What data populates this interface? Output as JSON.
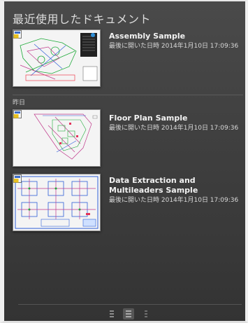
{
  "panel": {
    "title": "最近使用したドキュメント"
  },
  "groups": [
    {
      "label": "",
      "items": [
        {
          "name": "Assembly Sample",
          "meta": "最後に開いた日時 2014年1月10日 17:09:36"
        }
      ]
    },
    {
      "label": "昨日",
      "items": [
        {
          "name": "Floor Plan Sample",
          "meta": "最後に開いた日時 2014年1月10日 17:09:36"
        },
        {
          "name": "Data Extraction and Multileaders Sample",
          "meta": "最後に開いた日時 2014年1月10日 17:09:36"
        }
      ]
    }
  ],
  "footer": {
    "views": [
      "list-view-icon",
      "detail-view-icon",
      "compact-view-icon"
    ],
    "active_view": "detail-view-icon"
  },
  "colors": {
    "accent_green": "#1faa3a",
    "accent_magenta": "#c03a8c",
    "accent_blue": "#2f5fd8",
    "badge_yellow": "#e8c020"
  }
}
